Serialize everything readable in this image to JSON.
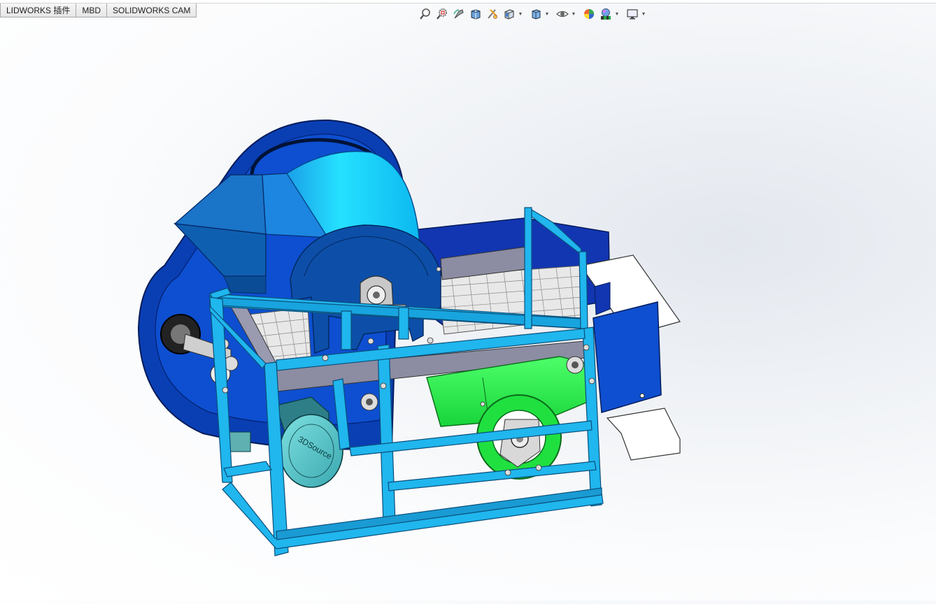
{
  "tabs": [
    {
      "label": "LIDWORKS 插件"
    },
    {
      "label": "MBD"
    },
    {
      "label": "SOLIDWORKS CAM"
    }
  ],
  "toolbar": {
    "tools": [
      "zoom-to-fit-icon",
      "zoom-to-area-icon",
      "previous-view-icon",
      "section-view-icon",
      "dynamic-annotation-view-icon",
      "view-orientation-icon",
      "display-style-icon",
      "hide-show-items-icon",
      "edit-appearance-icon",
      "apply-scene-icon",
      "view-settings-icon"
    ]
  },
  "model": {
    "motor_label": "3DSource"
  },
  "colors": {
    "frame": "#20b6ee",
    "frame_dark": "#1180b5",
    "housing": "#0a3fb4",
    "hopper": "#1a74c8",
    "drum": "#00cfff",
    "roller": "#22ee44",
    "motor": "#5cc8c8"
  }
}
